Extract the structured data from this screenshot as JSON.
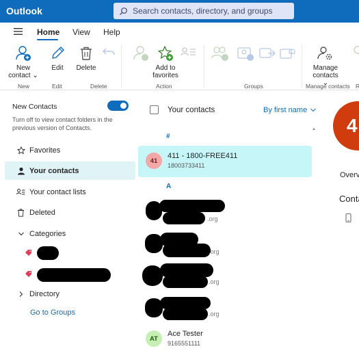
{
  "app": {
    "title": "Outlook"
  },
  "search": {
    "placeholder": "Search contacts, directory, and groups"
  },
  "menu": {
    "tabs": [
      "Home",
      "View",
      "Help"
    ],
    "active_tab": "Home"
  },
  "ribbon": {
    "new_contact_line1": "New",
    "new_contact_line2": "contact ⌄",
    "edit": "Edit",
    "delete": "Delete",
    "add_favorites_line1": "Add to",
    "add_favorites_line2": "favorites",
    "manage_line1": "Manage",
    "manage_line2": "contacts ⌄",
    "groups": {
      "new": "New",
      "edit": "Edit",
      "delete": "Delete",
      "action": "Action",
      "groups": "Groups",
      "manage": "Manage contacts",
      "cut": "R"
    }
  },
  "nav": {
    "new_contacts_label": "New Contacts",
    "new_contacts_on": true,
    "new_contacts_desc": "Turn off to view contact folders in the previous version of Contacts.",
    "items": {
      "favorites": "Favorites",
      "your_contacts": "Your contacts",
      "your_contact_lists": "Your contact lists",
      "deleted": "Deleted",
      "categories": "Categories",
      "directory": "Directory"
    },
    "go_to_groups": "Go to Groups"
  },
  "list": {
    "title": "Your contacts",
    "sort_label": "By first name",
    "sections": [
      "#",
      "A"
    ],
    "contacts": [
      {
        "initials": "41",
        "name": "411 - 1800-FREE411",
        "sub": "18003733411",
        "avatar_color": "#f4a7a7",
        "selected": true
      },
      {
        "initials": "AT",
        "name": "Ace Tester",
        "sub": "9165551111",
        "avatar_color": "#c6efb4",
        "selected": false
      }
    ],
    "redacted_suffixes": [
      ".org",
      ".org",
      ".org",
      ".org"
    ]
  },
  "detail": {
    "avatar_text": "4",
    "overview": "Overv",
    "contact_heading": "Conta",
    "accent": "#d13c0e"
  },
  "colors": {
    "brand": "#0f6cbd",
    "selected_row": "#c7f6f9",
    "nav_active": "#e0f4f8"
  }
}
